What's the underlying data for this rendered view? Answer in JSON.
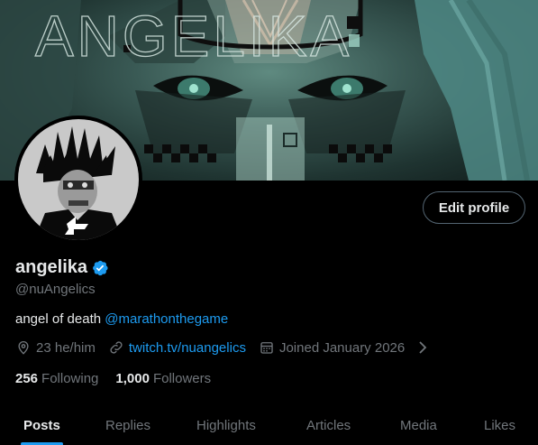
{
  "banner": {
    "word": "ANGELIKA"
  },
  "profile": {
    "display_name": "angelika",
    "handle": "@nuAngelics",
    "bio_text": "angel of death ",
    "bio_mention": "@marathonthegame",
    "pronouns": "23 he/him",
    "website": "twitch.tv/nuangelics",
    "joined": "Joined January 2026"
  },
  "actions": {
    "edit_profile": "Edit profile"
  },
  "stats": {
    "following_count": "256",
    "following_label": "Following",
    "followers_count": "1,000",
    "followers_label": "Followers"
  },
  "tabs": [
    "Posts",
    "Replies",
    "Highlights",
    "Articles",
    "Media",
    "Likes"
  ],
  "colors": {
    "accent": "#1d9bf0",
    "muted": "#71767b",
    "text": "#e7e9ea",
    "background": "#000000"
  },
  "icons": {
    "verified": "verified-badge-icon",
    "location": "location-pin-icon",
    "link": "link-icon",
    "calendar": "calendar-icon",
    "chevron": "chevron-right-icon"
  }
}
